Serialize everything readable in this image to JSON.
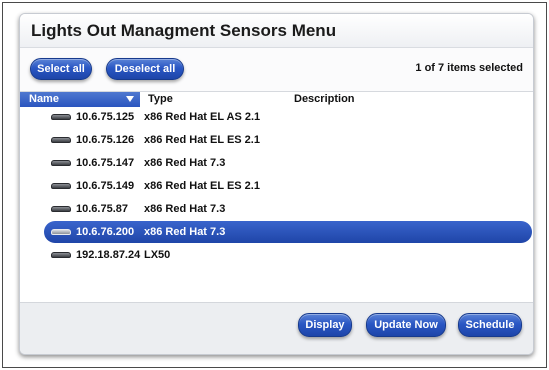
{
  "header": {
    "title": "Lights Out Managment Sensors Menu"
  },
  "toolbar": {
    "select_all_label": "Select all",
    "deselect_all_label": "Deselect all",
    "selection_status": "1 of 7 items selected"
  },
  "table": {
    "columns": [
      "Name",
      "Type",
      "Description"
    ],
    "sort_icon": "sort-down-icon",
    "rows": [
      {
        "name": "10.6.75.125",
        "type": "x86 Red Hat EL AS 2.1",
        "description": "",
        "selected": false,
        "icon": "disk-icon"
      },
      {
        "name": "10.6.75.126",
        "type": "x86 Red Hat EL ES 2.1",
        "description": "",
        "selected": false,
        "icon": "disk-icon"
      },
      {
        "name": "10.6.75.147",
        "type": "x86 Red Hat 7.3",
        "description": "",
        "selected": false,
        "icon": "disk-icon"
      },
      {
        "name": "10.6.75.149",
        "type": "x86 Red Hat EL ES 2.1",
        "description": "",
        "selected": false,
        "icon": "disk-icon"
      },
      {
        "name": "10.6.75.87",
        "type": "x86 Red Hat 7.3",
        "description": "",
        "selected": false,
        "icon": "disk-icon"
      },
      {
        "name": "10.6.76.200",
        "type": "x86 Red Hat 7.3",
        "description": "",
        "selected": true,
        "icon": "disk-icon"
      },
      {
        "name": "192.18.87.24",
        "type": "LX50",
        "description": "",
        "selected": false,
        "icon": "disk-icon"
      }
    ]
  },
  "footer": {
    "display_label": "Display",
    "update_now_label": "Update Now",
    "schedule_label": "Schedule"
  },
  "colors": {
    "button_blue": "#2a57c4",
    "selection_blue": "#1f45a8",
    "footer_gray": "#eceef1"
  }
}
